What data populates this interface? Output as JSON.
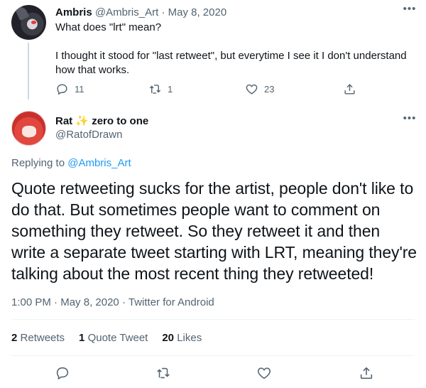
{
  "parent_tweet": {
    "name": "Ambris",
    "handle": "@Ambris_Art",
    "separator": "·",
    "date": "May 8, 2020",
    "text_line1": "What does \"lrt\" mean?",
    "text_line2": "I thought it stood for \"last retweet\", but everytime I see it I don't understand how that works.",
    "reply_count": "11",
    "retweet_count": "1",
    "like_count": "23"
  },
  "main_tweet": {
    "name": "Rat",
    "name_emoji": "✨",
    "name_suffix": "zero to one",
    "handle": "@RatofDrawn",
    "replying_prefix": "Replying to",
    "replying_to": "@Ambris_Art",
    "text": "Quote retweeting sucks for the artist, people don't like to do that. But sometimes people want to comment on something they retweet. So they retweet it and then write a separate tweet starting with LRT, meaning they're talking about the most recent thing they retweeted!",
    "time": "1:00 PM",
    "separator": "·",
    "date": "May 8, 2020",
    "source": "Twitter for Android",
    "stats": {
      "retweets_count": "2",
      "retweets_label": "Retweets",
      "quotes_count": "1",
      "quotes_label": "Quote Tweet",
      "likes_count": "20",
      "likes_label": "Likes"
    }
  },
  "icons": {
    "more": "more-horizontal-icon",
    "reply": "reply-icon",
    "retweet": "retweet-icon",
    "like": "heart-icon",
    "share": "share-icon"
  },
  "colors": {
    "link": "#1d9bf0",
    "muted": "#536471",
    "text": "#0f1419"
  }
}
